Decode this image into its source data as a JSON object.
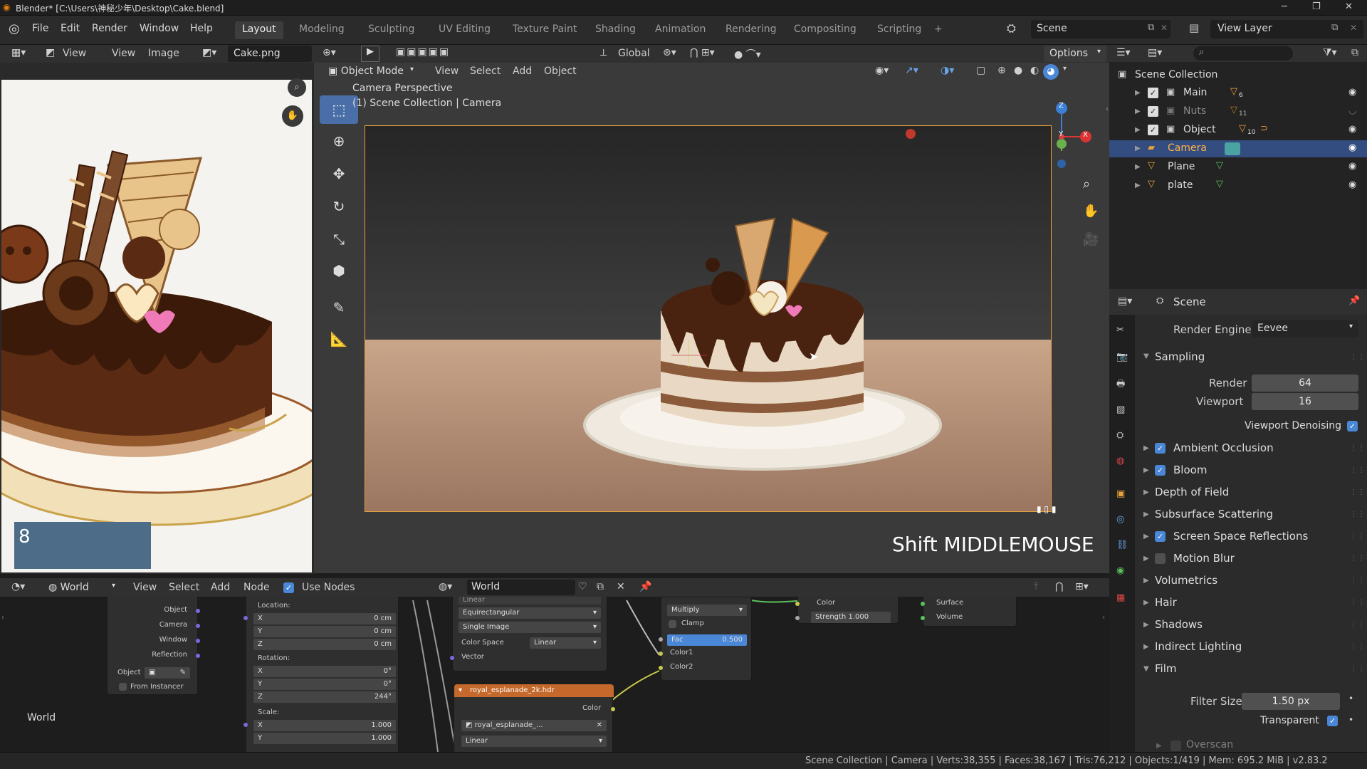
{
  "window": {
    "title": "Blender* [C:\\Users\\神秘少年\\Desktop\\Cake.blend]",
    "min": "─",
    "restore": "❐",
    "close": "✕"
  },
  "menu": [
    "File",
    "Edit",
    "Render",
    "Window",
    "Help"
  ],
  "workspaces": [
    "Layout",
    "Modeling",
    "Sculpting",
    "UV Editing",
    "Texture Paint",
    "Shading",
    "Animation",
    "Rendering",
    "Compositing",
    "Scripting",
    "+"
  ],
  "top_right": {
    "scene": "Scene",
    "view_layer": "View Layer"
  },
  "image_editor": {
    "view": "View",
    "view2": "View",
    "image": "Image",
    "filename": "Cake.png",
    "number_box": "8"
  },
  "viewport": {
    "mode": "Object Mode",
    "menu": [
      "View",
      "Select",
      "Add",
      "Object"
    ],
    "orientation": "Global",
    "options": "Options",
    "cam_title": "Camera Perspective",
    "cam_sub": "(1) Scene Collection | Camera",
    "shortcut": "Shift MIDDLEMOUSE",
    "gizmo": {
      "z": "Z",
      "y": "Y",
      "x": "X"
    }
  },
  "outliner": {
    "root": "Scene Collection",
    "items": [
      {
        "name": "Main",
        "badge": "6"
      },
      {
        "name": "Nuts",
        "badge": "11"
      },
      {
        "name": "Object",
        "badge": "10"
      },
      {
        "name": "Camera",
        "badge": ""
      },
      {
        "name": "Plane",
        "badge": ""
      },
      {
        "name": "plate",
        "badge": ""
      }
    ]
  },
  "properties": {
    "context": "Scene",
    "render_engine_label": "Render Engine",
    "render_engine": "Eevee",
    "sampling": "Sampling",
    "render_label": "Render",
    "render_val": "64",
    "viewport_label": "Viewport",
    "viewport_val": "16",
    "denoise": "Viewport Denoising",
    "sections": [
      {
        "name": "Ambient Occlusion",
        "check": true
      },
      {
        "name": "Bloom",
        "check": true
      },
      {
        "name": "Depth of Field",
        "check": null
      },
      {
        "name": "Subsurface Scattering",
        "check": null
      },
      {
        "name": "Screen Space Reflections",
        "check": true
      },
      {
        "name": "Motion Blur",
        "check": false
      },
      {
        "name": "Volumetrics",
        "check": null
      },
      {
        "name": "Hair",
        "check": null
      },
      {
        "name": "Shadows",
        "check": null
      },
      {
        "name": "Indirect Lighting",
        "check": null
      }
    ],
    "film": "Film",
    "filter_label": "Filter Size",
    "filter_val": "1.50 px",
    "transparent": "Transparent",
    "overscan": "Overscan"
  },
  "node_editor": {
    "world": "World",
    "menu": [
      "View",
      "Select",
      "Add",
      "Node"
    ],
    "use_nodes": "Use Nodes",
    "datablock": "World",
    "label_world": "World",
    "coord_outputs": [
      "Object",
      "Camera",
      "Window",
      "Reflection"
    ],
    "object_label": "Object",
    "from_instancer": "From Instancer",
    "mapping": {
      "location": "Location:",
      "rotation": "Rotation:",
      "scale": "Scale:",
      "loc": [
        {
          "a": "X",
          "v": "0 cm"
        },
        {
          "a": "Y",
          "v": "0 cm"
        },
        {
          "a": "Z",
          "v": "0 cm"
        }
      ],
      "rot": [
        {
          "a": "X",
          "v": "0°"
        },
        {
          "a": "Y",
          "v": "0°"
        },
        {
          "a": "Z",
          "v": "244°"
        }
      ],
      "scl": [
        {
          "a": "X",
          "v": "1.000"
        },
        {
          "a": "Y",
          "v": "1.000"
        }
      ]
    },
    "envtex": {
      "top": "Linear",
      "proj": "Equirectangular",
      "source": "Single Image",
      "cs_label": "Color Space",
      "cs_val": "Linear",
      "vector": "Vector"
    },
    "hdr": {
      "title": "royal_esplanade_2k.hdr",
      "color": "Color",
      "file": "royal_esplanade_...",
      "interp": "Linear"
    },
    "mix": {
      "mode": "Multiply",
      "clamp": "Clamp",
      "fac_label": "Fac",
      "fac_val": "0.500",
      "color1": "Color1",
      "color2": "Color2"
    },
    "bg": {
      "color": "Color",
      "strength_label": "Strength",
      "strength_val": "1.000"
    },
    "out": {
      "surface": "Surface",
      "volume": "Volume"
    }
  },
  "status": "Scene Collection | Camera | Verts:38,355 | Faces:38,167 | Tris:76,212 | Objects:1/419 | Mem: 695.2 MiB | v2.83.2"
}
